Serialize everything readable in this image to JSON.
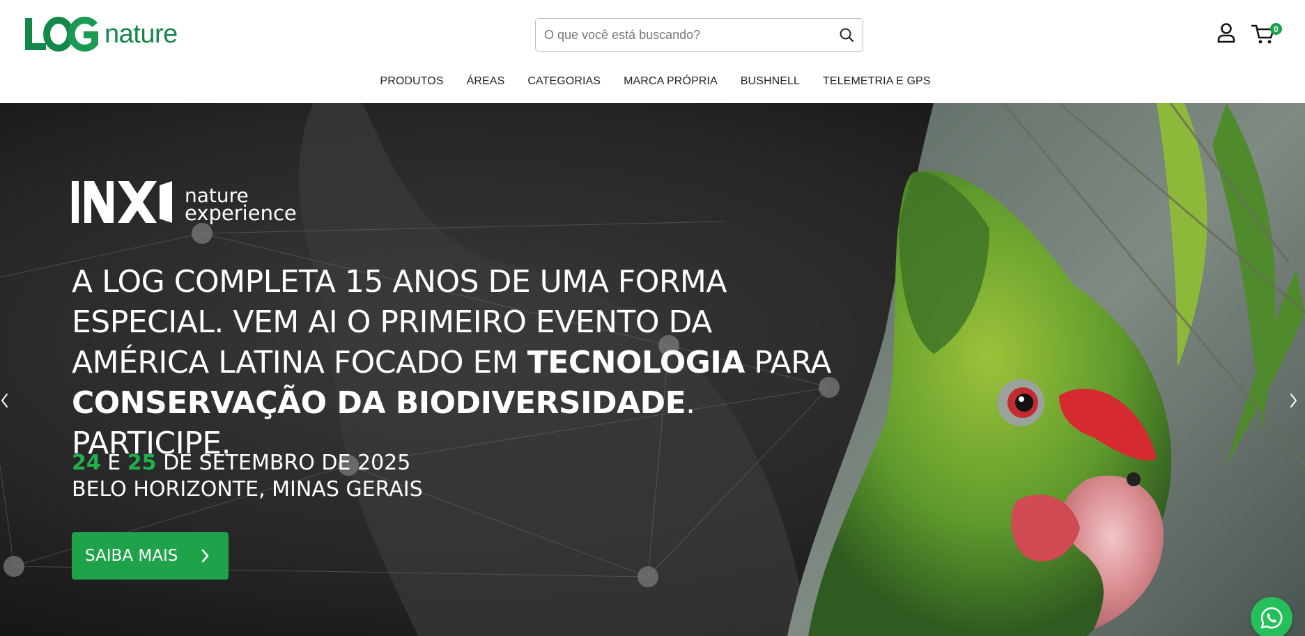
{
  "header": {
    "logo_text": "nature",
    "logo_mark_text": "LOG",
    "search": {
      "placeholder": "O que você está buscando?"
    },
    "cart_count": "0",
    "nav": [
      {
        "label": "PRODUTOS"
      },
      {
        "label": "ÁREAS"
      },
      {
        "label": "CATEGORIAS"
      },
      {
        "label": "MARCA PRÓPRIA"
      },
      {
        "label": "BUSHNELL"
      },
      {
        "label": "TELEMETRIA E GPS"
      }
    ]
  },
  "hero": {
    "event_logo": {
      "line1": "nature",
      "line2": "experience"
    },
    "headline": {
      "part1": "A LOG COMPLETA 15 ANOS DE UMA FORMA ESPECIAL. VEM AI O PRIMEIRO EVENTO DA AMÉRICA LATINA FOCADO EM ",
      "bold1": "TECNOLOGIA",
      "part2": " PARA ",
      "bold2": "CONSERVAÇÃO DA BIODIVERSIDADE",
      "part3": ". PARTICIPE."
    },
    "date": {
      "day1": "24",
      "conj": " E ",
      "day2": "25",
      "rest": " DE SETEMBRO DE 2025",
      "location": "BELO HORIZONTE, MINAS GERAIS"
    },
    "cta_label": "SAIBA MAIS"
  },
  "colors": {
    "brand_green": "#13884a",
    "accent_green": "#1ea34a",
    "whatsapp_green": "#25c05b"
  },
  "icons": [
    "search-icon",
    "user-icon",
    "cart-icon",
    "chevron-left-icon",
    "chevron-right-icon",
    "whatsapp-icon"
  ]
}
